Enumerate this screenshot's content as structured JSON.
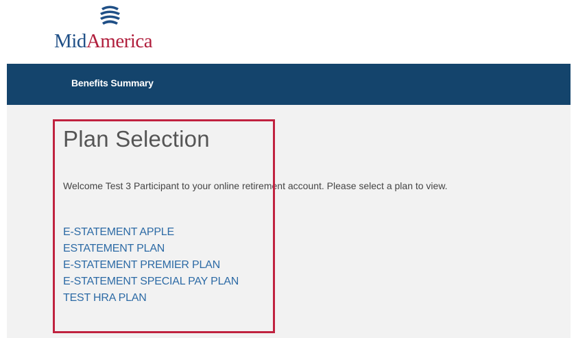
{
  "brand": {
    "name_part1": "Mid",
    "name_part2": "America",
    "colors": {
      "navy": "#1f4f86",
      "crimson": "#b01e3c",
      "navbar": "#14446c",
      "link": "#2c6aa5",
      "highlight": "#c0223f"
    }
  },
  "nav": {
    "items": [
      {
        "label": "Benefits Summary"
      }
    ]
  },
  "main": {
    "title": "Plan Selection",
    "welcome": "Welcome Test 3 Participant to your online retirement account. Please select a plan to view.",
    "plans": [
      {
        "label": "E-STATEMENT APPLE"
      },
      {
        "label": "ESTATEMENT PLAN"
      },
      {
        "label": "E-STATEMENT PREMIER PLAN"
      },
      {
        "label": "E-STATEMENT SPECIAL PAY PLAN"
      },
      {
        "label": "TEST HRA PLAN"
      }
    ]
  }
}
